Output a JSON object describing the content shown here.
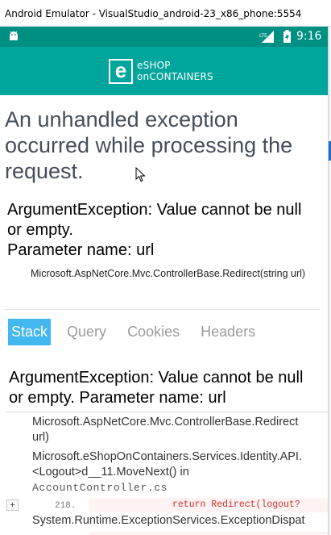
{
  "window": {
    "title": "Android Emulator - VisualStudio_android-23_x86_phone:5554"
  },
  "status_bar": {
    "time": "9:16",
    "network": "LTE"
  },
  "app": {
    "logo_letter": "e",
    "logo_line1": "eSHOP",
    "logo_line2": "onCONTAINERS"
  },
  "error_page": {
    "title": "An unhandled exception occurred while processing the request.",
    "exception_header": "ArgumentException: Value cannot be null or empty.",
    "exception_param": "Parameter name: url",
    "location": "Microsoft.AspNetCore.Mvc.ControllerBase.Redirect(string url)",
    "tabs": [
      {
        "label": "Stack",
        "active": true
      },
      {
        "label": "Query",
        "active": false
      },
      {
        "label": "Cookies",
        "active": false
      },
      {
        "label": "Headers",
        "active": false
      }
    ],
    "stack_header": "ArgumentException: Value cannot be null or empty. Parameter name: url",
    "frames": [
      {
        "line1": "Microsoft.AspNetCore.Mvc.ControllerBase.Redirect",
        "line2": "url)"
      },
      {
        "line1": "Microsoft.eShopOnContainers.Services.Identity.API.",
        "line2": "<Logout>d__11.MoveNext() in",
        "file": "AccountController.cs"
      }
    ],
    "expand_label": "+",
    "code_line_number": "218.",
    "code_line_text": "return Redirect(logout?",
    "system_frame": "System.Runtime.ExceptionServices.ExceptionDispat"
  },
  "colors": {
    "status_bar": "#008f83",
    "header": "#00a69c",
    "active_tab": "#43b8ee",
    "code_error": "#d32f2f"
  }
}
